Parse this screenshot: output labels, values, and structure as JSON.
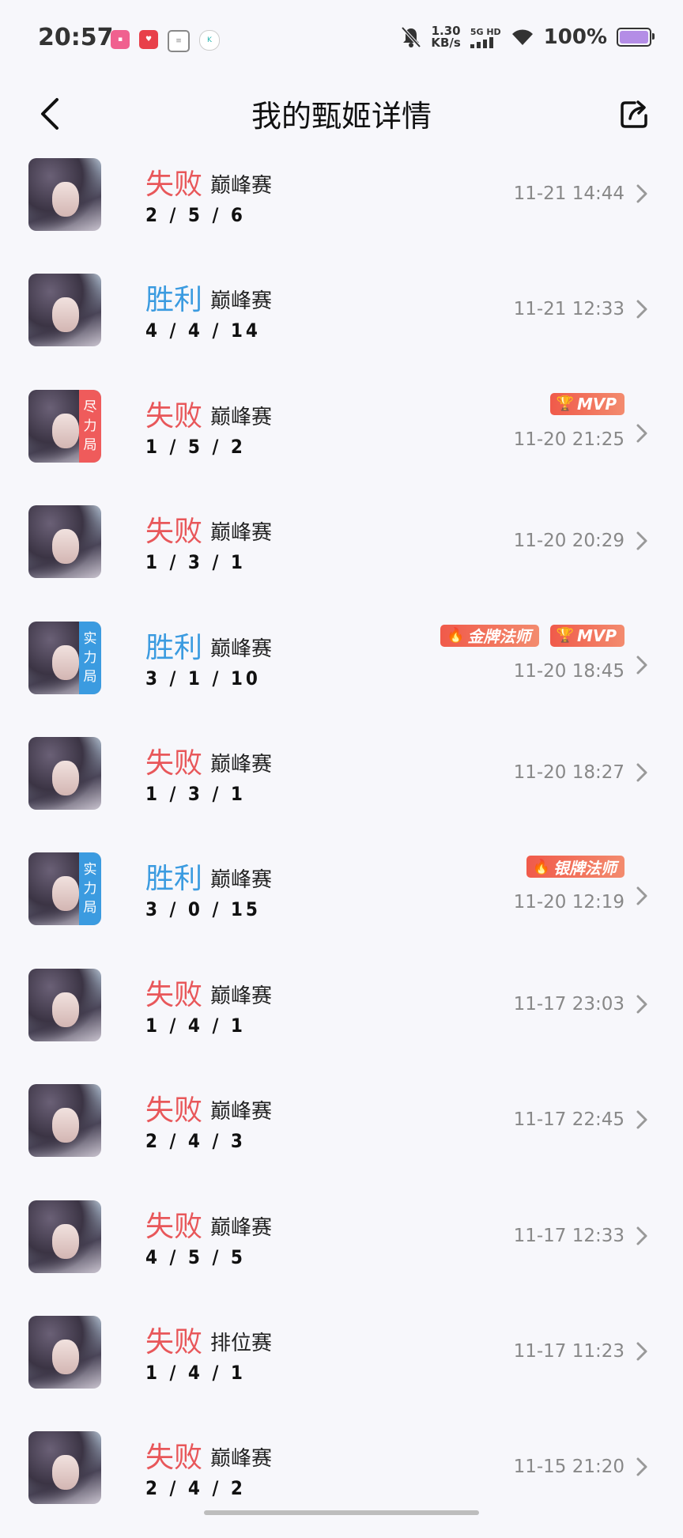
{
  "status_bar": {
    "time": "20:57",
    "net_speed_value": "1.30",
    "net_speed_unit": "KB/s",
    "network": "5G HD",
    "battery_text": "100%",
    "battery_level": 1.0,
    "battery_color": "#b48de6"
  },
  "header": {
    "title": "我的甄姬详情",
    "back_icon": "chevron-left-icon",
    "share_icon": "share-icon"
  },
  "colors": {
    "loss": "#e8575a",
    "win": "#3b9be0",
    "tag_red": "#ef5b5b",
    "tag_blue": "#3b9be0"
  },
  "matches": [
    {
      "result": "失败",
      "outcome": "loss",
      "mode": "巅峰赛",
      "kda": "2 / 5 / 6",
      "time": "11-21 14:44",
      "tag": "",
      "badges": []
    },
    {
      "result": "胜利",
      "outcome": "win",
      "mode": "巅峰赛",
      "kda": "4 / 4 / 14",
      "time": "11-21 12:33",
      "tag": "",
      "badges": []
    },
    {
      "result": "失败",
      "outcome": "loss",
      "mode": "巅峰赛",
      "kda": "1 / 5 / 2",
      "time": "11-20 21:25",
      "tag": "尽力局",
      "badges": [
        "MVP"
      ]
    },
    {
      "result": "失败",
      "outcome": "loss",
      "mode": "巅峰赛",
      "kda": "1 / 3 / 1",
      "time": "11-20 20:29",
      "tag": "",
      "badges": []
    },
    {
      "result": "胜利",
      "outcome": "win",
      "mode": "巅峰赛",
      "kda": "3 / 1 / 10",
      "time": "11-20 18:45",
      "tag": "实力局",
      "badges": [
        "金牌法师",
        "MVP"
      ]
    },
    {
      "result": "失败",
      "outcome": "loss",
      "mode": "巅峰赛",
      "kda": "1 / 3 / 1",
      "time": "11-20 18:27",
      "tag": "",
      "badges": []
    },
    {
      "result": "胜利",
      "outcome": "win",
      "mode": "巅峰赛",
      "kda": "3 / 0 / 15",
      "time": "11-20 12:19",
      "tag": "实力局",
      "badges": [
        "银牌法师"
      ]
    },
    {
      "result": "失败",
      "outcome": "loss",
      "mode": "巅峰赛",
      "kda": "1 / 4 / 1",
      "time": "11-17 23:03",
      "tag": "",
      "badges": []
    },
    {
      "result": "失败",
      "outcome": "loss",
      "mode": "巅峰赛",
      "kda": "2 / 4 / 3",
      "time": "11-17 22:45",
      "tag": "",
      "badges": []
    },
    {
      "result": "失败",
      "outcome": "loss",
      "mode": "巅峰赛",
      "kda": "4 / 5 / 5",
      "time": "11-17 12:33",
      "tag": "",
      "badges": []
    },
    {
      "result": "失败",
      "outcome": "loss",
      "mode": "排位赛",
      "kda": "1 / 4 / 1",
      "time": "11-17 11:23",
      "tag": "",
      "badges": []
    },
    {
      "result": "失败",
      "outcome": "loss",
      "mode": "巅峰赛",
      "kda": "2 / 4 / 2",
      "time": "11-15 21:20",
      "tag": "",
      "badges": []
    }
  ]
}
